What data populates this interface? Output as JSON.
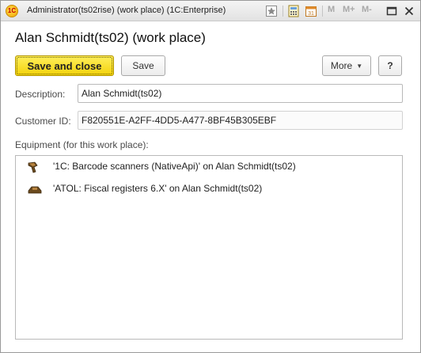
{
  "window": {
    "title": "Administrator(ts02rise) (work place)  (1C:Enterprise)",
    "logo_text": "1C",
    "toolbar": {
      "m_label": "M",
      "m_plus_label": "M+",
      "m_minus_label": "M-"
    }
  },
  "form": {
    "title": "Alan Schmidt(ts02)  (work place)",
    "buttons": {
      "save_and_close": "Save and close",
      "save": "Save",
      "more": "More",
      "help": "?"
    },
    "description": {
      "label": "Description:",
      "value": "Alan Schmidt(ts02)"
    },
    "customer_id": {
      "label": "Customer ID:",
      "value": "F820551E-A2FF-4DD5-A477-8BF45B305EBF"
    },
    "equipment": {
      "label": "Equipment (for this work place):",
      "items": [
        {
          "icon": "barcode-scanner-icon",
          "text": "'1C: Barcode scanners (NativeApi)' on Alan Schmidt(ts02)"
        },
        {
          "icon": "fiscal-register-icon",
          "text": "'ATOL: Fiscal registers 6.X' on Alan Schmidt(ts02)"
        }
      ]
    }
  },
  "colors": {
    "primary_button": "#f3d20a",
    "titlebar": "#e2e2e2"
  }
}
